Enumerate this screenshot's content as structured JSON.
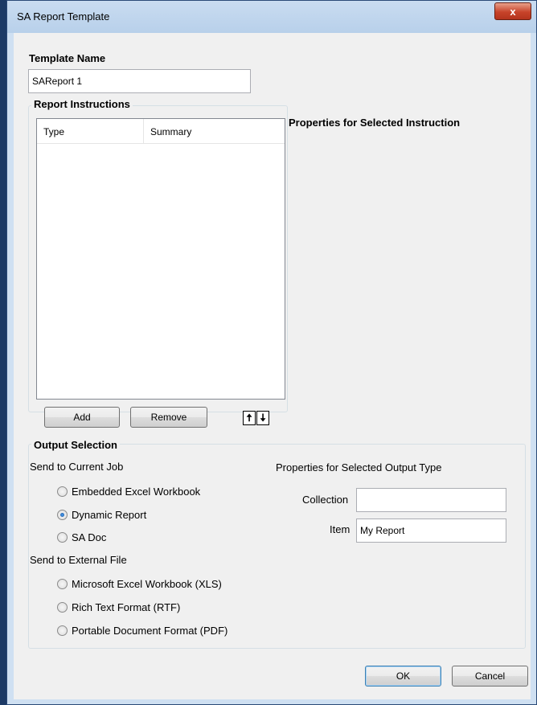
{
  "window": {
    "title": "SA Report Template",
    "close_glyph": "x"
  },
  "template_name": {
    "label": "Template Name",
    "value": "SAReport 1"
  },
  "report_instructions": {
    "caption": "Report Instructions",
    "columns": [
      "Type",
      "Summary"
    ],
    "add_label": "Add",
    "remove_label": "Remove",
    "move_up_glyph": "🠅",
    "move_down_glyph": "🠇"
  },
  "properties_selected_instruction": {
    "title": "Properties for Selected Instruction"
  },
  "output_selection": {
    "caption": "Output Selection",
    "current_job_label": "Send to Current Job",
    "current_job_options": [
      {
        "label": "Embedded Excel Workbook",
        "checked": false
      },
      {
        "label": "Dynamic Report",
        "checked": true
      },
      {
        "label": "SA Doc",
        "checked": false
      }
    ],
    "external_file_label": "Send to External File",
    "external_file_options": [
      {
        "label": "Microsoft Excel Workbook (XLS)",
        "checked": false
      },
      {
        "label": "Rich Text Format (RTF)",
        "checked": false
      },
      {
        "label": "Portable Document Format (PDF)",
        "checked": false
      }
    ],
    "properties_title": "Properties for Selected Output Type",
    "collection_label": "Collection",
    "collection_value": "",
    "item_label": "Item",
    "item_value": "My Report"
  },
  "footer": {
    "ok_label": "OK",
    "cancel_label": "Cancel"
  }
}
